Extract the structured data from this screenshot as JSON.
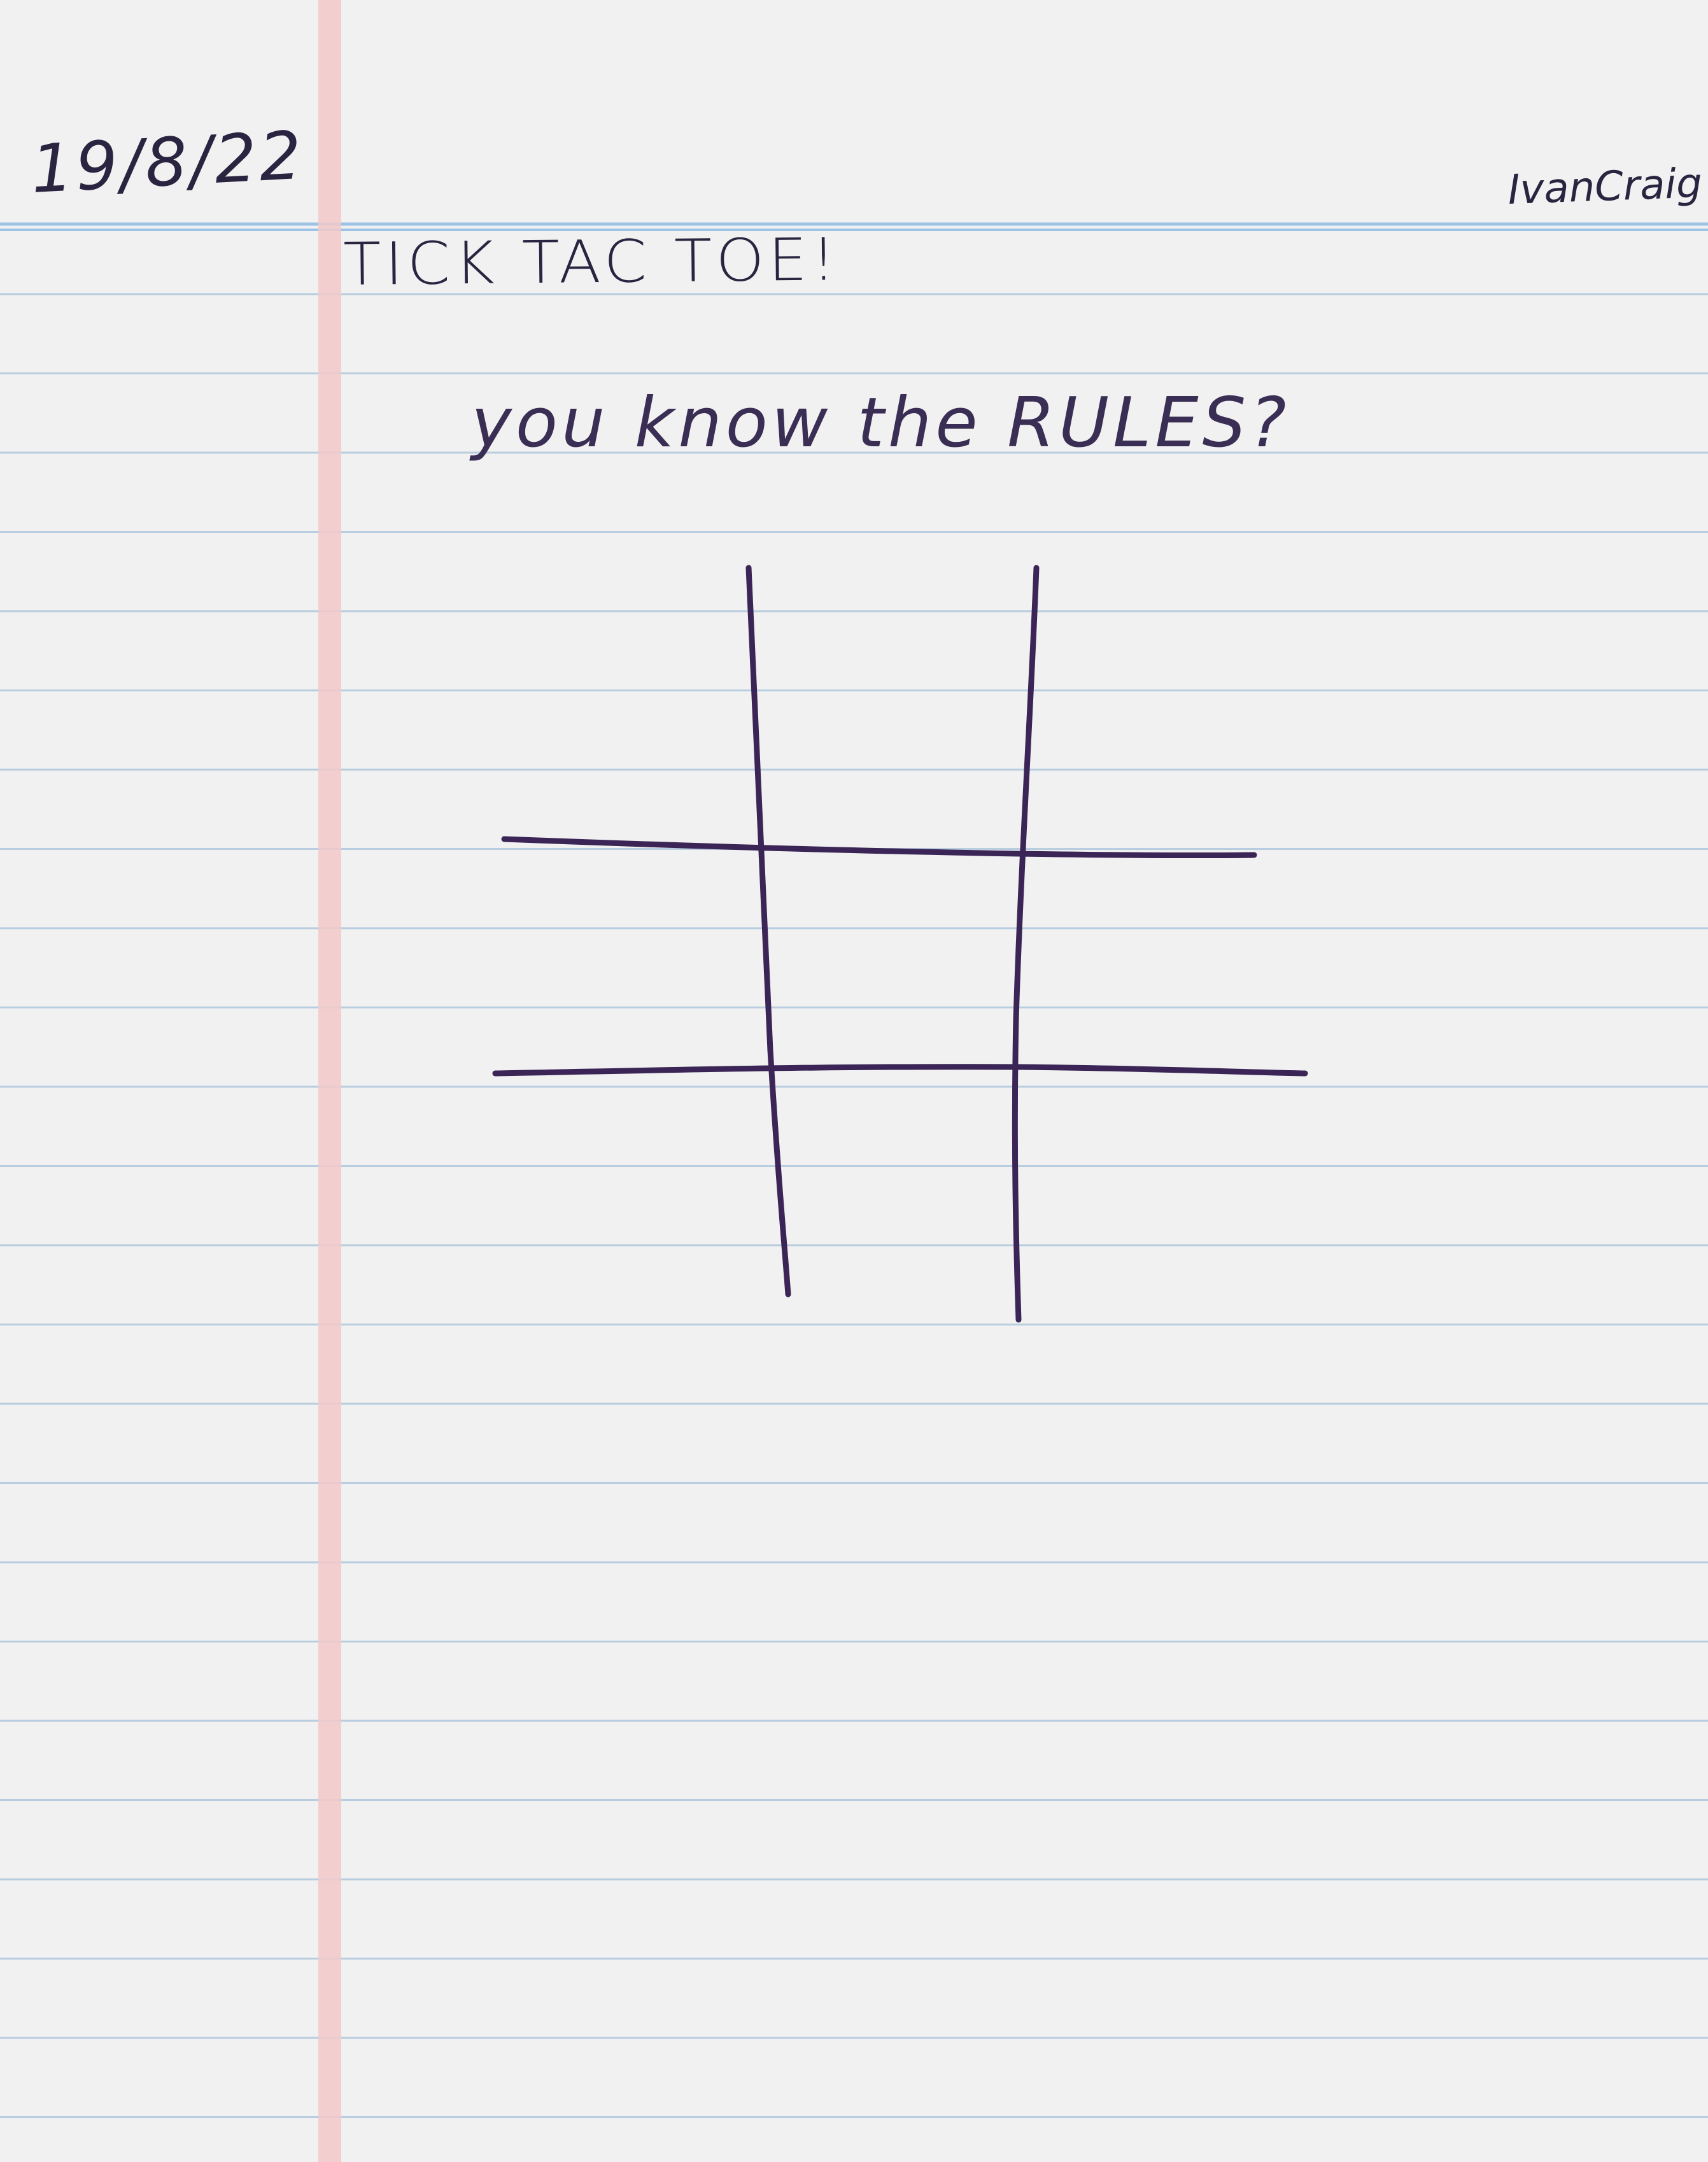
{
  "page": {
    "date": "19/8/22",
    "author": "IvanCraig",
    "title": "TICK TAC TOE!",
    "subtitle": "you know the RULES?"
  },
  "colors": {
    "paper": "#f1f1f1",
    "rule_line": "#b8cde0",
    "header_line": "#9cc3e6",
    "margin_line": "#f2c5c5",
    "ink": "#3a2556"
  },
  "board": {
    "rows": 3,
    "cols": 3
  }
}
